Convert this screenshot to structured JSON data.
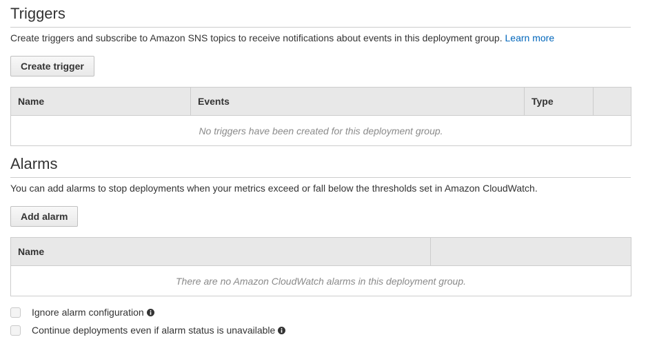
{
  "triggers": {
    "title": "Triggers",
    "description": "Create triggers and subscribe to Amazon SNS topics to receive notifications about events in this deployment group.",
    "learn_more": "Learn more",
    "create_button": "Create trigger",
    "columns": [
      "Name",
      "Events",
      "Type",
      ""
    ],
    "empty_message": "No triggers have been created for this deployment group."
  },
  "alarms": {
    "title": "Alarms",
    "description": "You can add alarms to stop deployments when your metrics exceed or fall below the thresholds set in Amazon CloudWatch.",
    "add_button": "Add alarm",
    "columns": [
      "Name",
      ""
    ],
    "empty_message": "There are no Amazon CloudWatch alarms in this deployment group."
  },
  "options": [
    {
      "label": "Ignore alarm configuration",
      "checked": false,
      "icon": "info-icon"
    },
    {
      "label": "Continue deployments even if alarm status is unavailable",
      "checked": false,
      "icon": "info-icon"
    }
  ],
  "colors": {
    "link": "#0066bb",
    "header_bg": "#e8e8e8",
    "border": "#cccccc"
  }
}
